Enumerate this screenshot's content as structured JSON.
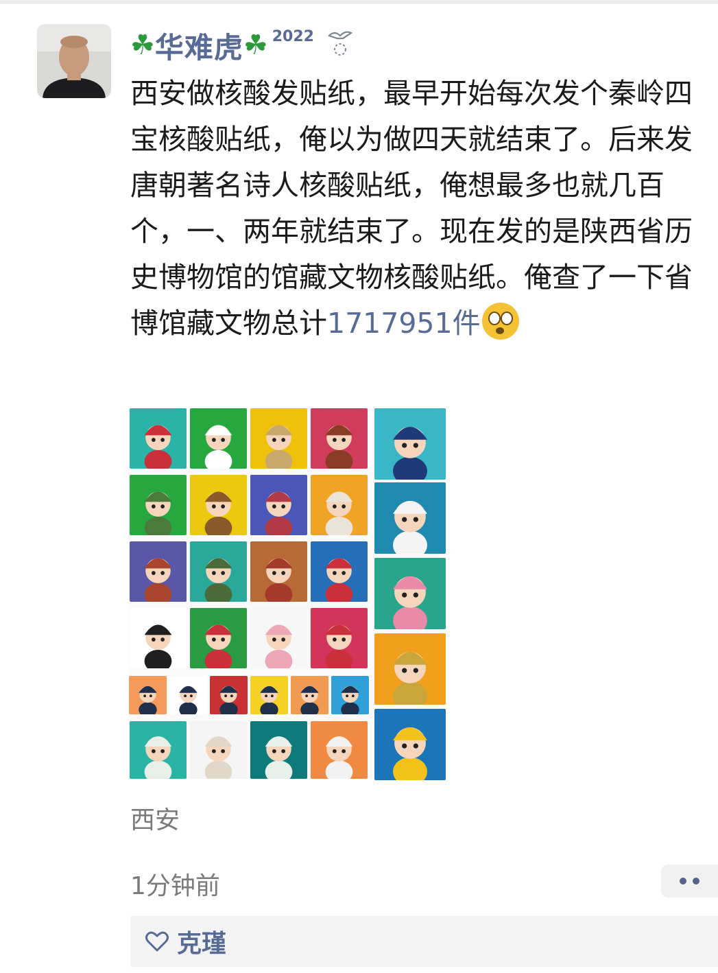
{
  "post": {
    "username": "华难虎",
    "year_badge": "2022",
    "text_main": "西安做核酸发贴纸，最早开始每次发个秦岭四宝核酸贴纸，俺以为做四天就结束了。后来发唐朝著名诗人核酸贴纸，俺想最多也就几百个，一、两年就结束了。现在发的是陕西省历史博物馆的馆藏文物核酸贴纸。俺查了一下省博馆藏文物总计",
    "count_text": "1717951件",
    "emoji": "flushed-face",
    "location": "西安",
    "time": "1分钟前"
  },
  "likes": {
    "names": "克瑾",
    "icon": "heart-outline-icon"
  },
  "colors": {
    "link": "#586b94",
    "meta": "#7a7a7a",
    "text": "#1b1b1b"
  },
  "image_grid": {
    "tiles": [
      {
        "color": "#2bb3a8",
        "fig": "#c9303c"
      },
      {
        "color": "#27a83f",
        "fig": "#ffffff"
      },
      {
        "color": "#f0c10b",
        "fig": "#c9a86b"
      },
      {
        "color": "#d23c5c",
        "fig": "#8a3b24"
      },
      {
        "color": "#27a83f",
        "fig": "#4b7a3a"
      },
      {
        "color": "#ebc90f",
        "fig": "#8a5a2a"
      },
      {
        "color": "#4a56b8",
        "fig": "#b23a46"
      },
      {
        "color": "#f0a426",
        "fig": "#e9e3d8"
      },
      {
        "color": "#5a56a8",
        "fig": "#a8452c"
      },
      {
        "color": "#2aa99a",
        "fig": "#4a6a3a"
      },
      {
        "color": "#b86a36",
        "fig": "#a53a2a"
      },
      {
        "color": "#246fb8",
        "fig": "#c9303c"
      },
      {
        "color": "#ffffff",
        "fig": "#1f1f1f"
      },
      {
        "color": "#2a9a43",
        "fig": "#c9303c"
      },
      {
        "color": "#f7f7f7",
        "fig": "#eda7b7"
      },
      {
        "color": "#d2345a",
        "fig": "#c9303c"
      },
      {
        "color": "#f59a5a",
        "fig": "#20304a"
      },
      {
        "color": "#ffffff",
        "fig": "#20304a"
      },
      {
        "color": "#c83232",
        "fig": "#20304a"
      },
      {
        "color": "#f3d225",
        "fig": "#20304a"
      },
      {
        "color": "#f09a52",
        "fig": "#20304a"
      },
      {
        "color": "#2fa0d8",
        "fig": "#20304a"
      },
      {
        "color": "#2ab4a6",
        "fig": "#e8efe8"
      },
      {
        "color": "#f5f5f5",
        "fig": "#e0d8c8"
      },
      {
        "color": "#0f7a7a",
        "fig": "#e8f0ec"
      },
      {
        "color": "#f08a42",
        "fig": "#f2f2f2"
      },
      {
        "color": "#3ab7c6",
        "fig": "#1f3a78"
      },
      {
        "color": "#1f8ab0",
        "fig": "#f4f4f4"
      },
      {
        "color": "#28a58a",
        "fig": "#e88aa8"
      },
      {
        "color": "#f0a01a",
        "fig": "#c9a53a"
      },
      {
        "color": "#1c75b8",
        "fig": "#f2c21a"
      }
    ]
  }
}
